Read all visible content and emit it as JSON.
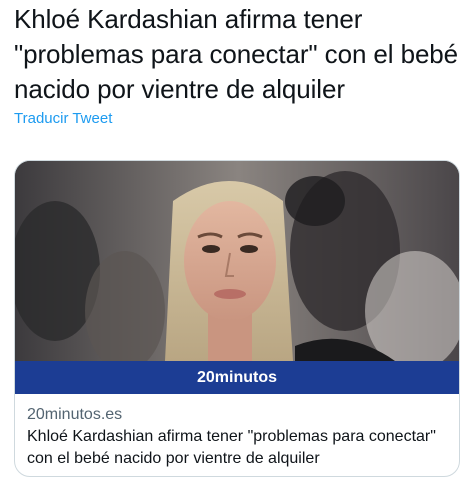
{
  "tweet": {
    "text": "Khloé Kardashian afirma tener \"problemas para conectar\" con el bebé nacido por vientre de alquiler",
    "translate_label": "Traducir Tweet"
  },
  "card": {
    "brand": "20minutos",
    "domain": "20minutos.es",
    "title": "Khloé Kardashian afirma tener \"problemas para conectar\" con el bebé nacido por vientre de alquiler"
  },
  "colors": {
    "link": "#1d9bf0",
    "brand_bar": "#1c3d94",
    "border": "#cfd9de"
  }
}
